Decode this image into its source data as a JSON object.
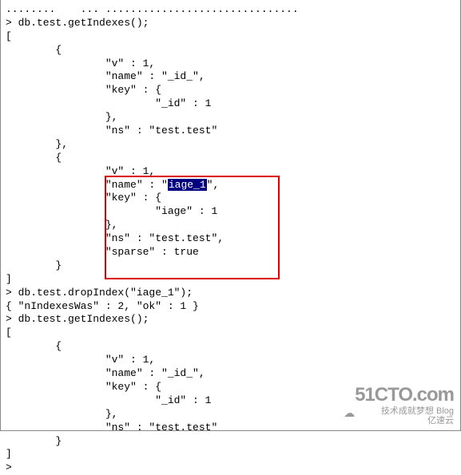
{
  "header_garbage": "........    ... ...............................",
  "cmd1": "> db.test.getIndexes();",
  "open_br": "[",
  "obj_open": "        {",
  "idx1_v": "                \"v\" : 1,",
  "idx1_name": "                \"name\" : \"_id_\",",
  "idx1_key": "                \"key\" : {",
  "idx1_id": "                        \"_id\" : 1",
  "idx1_kc": "                },",
  "idx1_ns": "                \"ns\" : \"test.test\"",
  "obj_close_c": "        },",
  "idx2_v": "                \"v\" : 1,",
  "idx2_name_pre": "                \"name\" : \"",
  "idx2_name_hl": "iage_1",
  "idx2_name_post": "\",",
  "idx2_key": "                \"key\" : {",
  "idx2_iage": "                        \"iage\" : 1",
  "idx2_kc": "                },",
  "idx2_ns": "                \"ns\" : \"test.test\",",
  "idx2_sparse": "                \"sparse\" : true",
  "obj_close": "        }",
  "close_br": "]",
  "cmd2": "> db.test.dropIndex(\"iage_1\");",
  "res2": "{ \"nIndexesWas\" : 2, \"ok\" : 1 }",
  "cmd3": "> db.test.getIndexes();",
  "prompt": ">",
  "wm_big": "51CTO.com",
  "wm_small": "技术成就梦想   Blog",
  "wm_small2": "亿速云"
}
